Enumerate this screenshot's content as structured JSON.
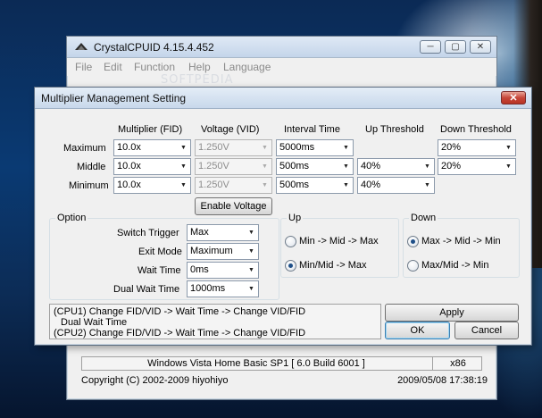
{
  "main_window": {
    "title": "CrystalCPUID 4.15.4.452",
    "menu": [
      "File",
      "Edit",
      "Function",
      "Help",
      "Language"
    ],
    "status_os": "Windows Vista Home Basic SP1 [ 6.0 Build 6001 ]",
    "status_arch": "x86",
    "copyright": "Copyright (C) 2002-2009 hiyohiyo",
    "date": "2009/05/08 17:38:19"
  },
  "watermark": "SOFTPEDIA",
  "dialog": {
    "title": "Multiplier Management Setting",
    "close_label": "✕",
    "column_headers": {
      "multiplier": "Multiplier (FID)",
      "voltage": "Voltage (VID)",
      "interval": "Interval Time",
      "up_threshold": "Up Threshold",
      "down_threshold": "Down Threshold"
    },
    "rows": [
      {
        "label": "Maximum",
        "multiplier": "10.0x",
        "voltage": "1.250V",
        "interval": "5000ms",
        "down_threshold": "20%"
      },
      {
        "label": "Middle",
        "multiplier": "10.0x",
        "voltage": "1.250V",
        "interval": "500ms",
        "up_threshold": "40%",
        "down_threshold": "20%"
      },
      {
        "label": "Minimum",
        "multiplier": "10.0x",
        "voltage": "1.250V",
        "interval": "500ms",
        "up_threshold": "40%"
      }
    ],
    "enable_voltage_label": "Enable Voltage",
    "option": {
      "title": "Option",
      "switch_trigger_label": "Switch Trigger",
      "switch_trigger": "Max",
      "exit_mode_label": "Exit Mode",
      "exit_mode": "Maximum",
      "wait_time_label": "Wait Time",
      "wait_time": "0ms",
      "dual_wait_time_label": "Dual Wait Time",
      "dual_wait_time": "1000ms"
    },
    "up": {
      "title": "Up",
      "option1": "Min -> Mid -> Max",
      "option2": "Min/Mid -> Max",
      "selected": 2
    },
    "down": {
      "title": "Down",
      "option1": "Max -> Mid -> Min",
      "option2": "Max/Mid -> Min",
      "selected": 1
    },
    "info_lines": [
      "(CPU1) Change FID/VID -> Wait Time -> Change VID/FID",
      "Dual Wait Time",
      "(CPU2) Change FID/VID -> Wait Time -> Change VID/FID"
    ],
    "apply_label": "Apply",
    "ok_label": "OK",
    "cancel_label": "Cancel"
  }
}
